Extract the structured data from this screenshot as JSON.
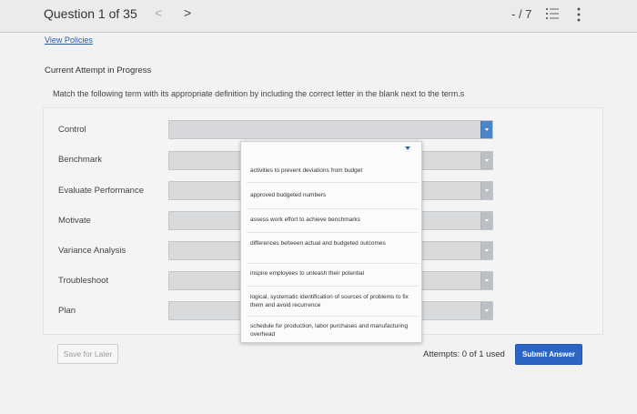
{
  "header": {
    "question_label": "Question 1 of 35",
    "prev_glyph": "<",
    "next_glyph": ">",
    "score": "- / 7"
  },
  "links": {
    "view_policies": "View Policies"
  },
  "attempt_title": "Current Attempt in Progress",
  "instructions": "Match the following term with its appropriate definition by including the correct letter in the blank next to the term.s",
  "terms": [
    "Control",
    "Benchmark",
    "Evaluate Performance",
    "Motivate",
    "Variance Analysis",
    "Troubleshoot",
    "Plan"
  ],
  "dropdown_options": [
    "activities to prevent deviations from budget",
    "approved budgeted numbers",
    "assess work effort to achieve benchmarks",
    "differences between actual and budgeted outcomes",
    "inspire employees to unleash their potential",
    "logical, systematic identification of sources of problems to fix them and avoid recurrence",
    "schedule for production, labor purchases and manufacturing overhead"
  ],
  "footer": {
    "save_label": "Save for Later",
    "attempts": "Attempts: 0 of 1 used",
    "submit_label": "Submit Answer"
  },
  "colors": {
    "accent": "#2c66c4",
    "select_active_arrow": "#4a86c5"
  }
}
